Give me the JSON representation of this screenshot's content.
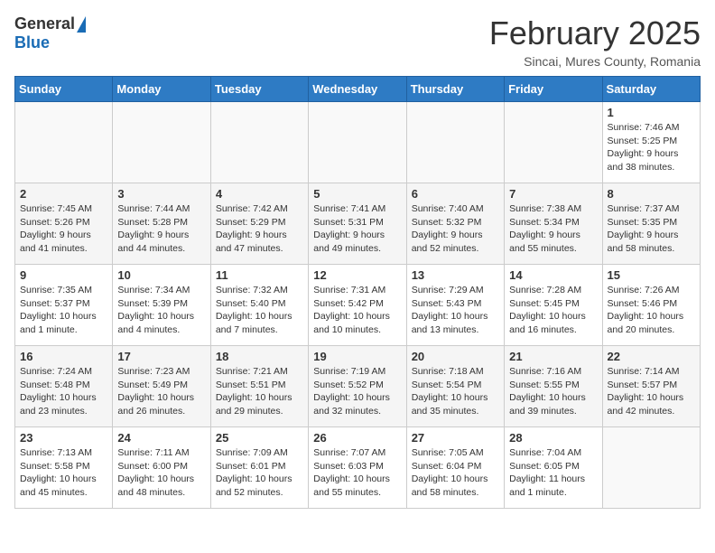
{
  "header": {
    "logo": {
      "general": "General",
      "blue": "Blue"
    },
    "month_year": "February 2025",
    "location": "Sincai, Mures County, Romania"
  },
  "calendar": {
    "days_of_week": [
      "Sunday",
      "Monday",
      "Tuesday",
      "Wednesday",
      "Thursday",
      "Friday",
      "Saturday"
    ],
    "weeks": [
      [
        {
          "day": null,
          "info": null
        },
        {
          "day": null,
          "info": null
        },
        {
          "day": null,
          "info": null
        },
        {
          "day": null,
          "info": null
        },
        {
          "day": null,
          "info": null
        },
        {
          "day": null,
          "info": null
        },
        {
          "day": "1",
          "info": "Sunrise: 7:46 AM\nSunset: 5:25 PM\nDaylight: 9 hours and 38 minutes."
        }
      ],
      [
        {
          "day": "2",
          "info": "Sunrise: 7:45 AM\nSunset: 5:26 PM\nDaylight: 9 hours and 41 minutes."
        },
        {
          "day": "3",
          "info": "Sunrise: 7:44 AM\nSunset: 5:28 PM\nDaylight: 9 hours and 44 minutes."
        },
        {
          "day": "4",
          "info": "Sunrise: 7:42 AM\nSunset: 5:29 PM\nDaylight: 9 hours and 47 minutes."
        },
        {
          "day": "5",
          "info": "Sunrise: 7:41 AM\nSunset: 5:31 PM\nDaylight: 9 hours and 49 minutes."
        },
        {
          "day": "6",
          "info": "Sunrise: 7:40 AM\nSunset: 5:32 PM\nDaylight: 9 hours and 52 minutes."
        },
        {
          "day": "7",
          "info": "Sunrise: 7:38 AM\nSunset: 5:34 PM\nDaylight: 9 hours and 55 minutes."
        },
        {
          "day": "8",
          "info": "Sunrise: 7:37 AM\nSunset: 5:35 PM\nDaylight: 9 hours and 58 minutes."
        }
      ],
      [
        {
          "day": "9",
          "info": "Sunrise: 7:35 AM\nSunset: 5:37 PM\nDaylight: 10 hours and 1 minute."
        },
        {
          "day": "10",
          "info": "Sunrise: 7:34 AM\nSunset: 5:39 PM\nDaylight: 10 hours and 4 minutes."
        },
        {
          "day": "11",
          "info": "Sunrise: 7:32 AM\nSunset: 5:40 PM\nDaylight: 10 hours and 7 minutes."
        },
        {
          "day": "12",
          "info": "Sunrise: 7:31 AM\nSunset: 5:42 PM\nDaylight: 10 hours and 10 minutes."
        },
        {
          "day": "13",
          "info": "Sunrise: 7:29 AM\nSunset: 5:43 PM\nDaylight: 10 hours and 13 minutes."
        },
        {
          "day": "14",
          "info": "Sunrise: 7:28 AM\nSunset: 5:45 PM\nDaylight: 10 hours and 16 minutes."
        },
        {
          "day": "15",
          "info": "Sunrise: 7:26 AM\nSunset: 5:46 PM\nDaylight: 10 hours and 20 minutes."
        }
      ],
      [
        {
          "day": "16",
          "info": "Sunrise: 7:24 AM\nSunset: 5:48 PM\nDaylight: 10 hours and 23 minutes."
        },
        {
          "day": "17",
          "info": "Sunrise: 7:23 AM\nSunset: 5:49 PM\nDaylight: 10 hours and 26 minutes."
        },
        {
          "day": "18",
          "info": "Sunrise: 7:21 AM\nSunset: 5:51 PM\nDaylight: 10 hours and 29 minutes."
        },
        {
          "day": "19",
          "info": "Sunrise: 7:19 AM\nSunset: 5:52 PM\nDaylight: 10 hours and 32 minutes."
        },
        {
          "day": "20",
          "info": "Sunrise: 7:18 AM\nSunset: 5:54 PM\nDaylight: 10 hours and 35 minutes."
        },
        {
          "day": "21",
          "info": "Sunrise: 7:16 AM\nSunset: 5:55 PM\nDaylight: 10 hours and 39 minutes."
        },
        {
          "day": "22",
          "info": "Sunrise: 7:14 AM\nSunset: 5:57 PM\nDaylight: 10 hours and 42 minutes."
        }
      ],
      [
        {
          "day": "23",
          "info": "Sunrise: 7:13 AM\nSunset: 5:58 PM\nDaylight: 10 hours and 45 minutes."
        },
        {
          "day": "24",
          "info": "Sunrise: 7:11 AM\nSunset: 6:00 PM\nDaylight: 10 hours and 48 minutes."
        },
        {
          "day": "25",
          "info": "Sunrise: 7:09 AM\nSunset: 6:01 PM\nDaylight: 10 hours and 52 minutes."
        },
        {
          "day": "26",
          "info": "Sunrise: 7:07 AM\nSunset: 6:03 PM\nDaylight: 10 hours and 55 minutes."
        },
        {
          "day": "27",
          "info": "Sunrise: 7:05 AM\nSunset: 6:04 PM\nDaylight: 10 hours and 58 minutes."
        },
        {
          "day": "28",
          "info": "Sunrise: 7:04 AM\nSunset: 6:05 PM\nDaylight: 11 hours and 1 minute."
        },
        {
          "day": null,
          "info": null
        }
      ]
    ]
  }
}
